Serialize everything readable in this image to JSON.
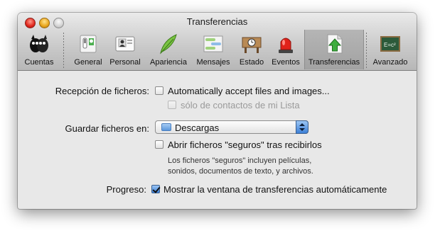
{
  "window": {
    "title": "Transferencias"
  },
  "toolbar": {
    "items": [
      {
        "label": "Cuentas",
        "icon": "accounts-icon"
      },
      {
        "label": "General",
        "icon": "general-switch-icon"
      },
      {
        "label": "Personal",
        "icon": "personal-card-icon"
      },
      {
        "label": "Apariencia",
        "icon": "feather-icon"
      },
      {
        "label": "Mensajes",
        "icon": "messages-icon"
      },
      {
        "label": "Estado",
        "icon": "status-sign-icon"
      },
      {
        "label": "Eventos",
        "icon": "siren-light-icon"
      },
      {
        "label": "Transferencias",
        "icon": "transfer-arrow-icon",
        "selected": true
      },
      {
        "label": "Avanzado",
        "icon": "chalkboard-icon"
      }
    ]
  },
  "form": {
    "reception_label": "Recepción de ficheros:",
    "auto_accept_label": "Automatically accept files and images...",
    "auto_accept_checked": false,
    "only_contacts_label": "sólo de contactos de mi Lista",
    "only_contacts_checked": false,
    "only_contacts_enabled": false,
    "save_in_label": "Guardar ficheros en:",
    "save_in_value": "Descargas",
    "open_safe_label": "Abrir ficheros \"seguros\" tras recibirlos",
    "open_safe_checked": false,
    "safe_note_line1": "Los ficheros \"seguros\" incluyen películas,",
    "safe_note_line2": "sonidos, documentos de texto, y archivos.",
    "progress_label": "Progreso:",
    "show_window_label": "Mostrar la ventana de transferencias automáticamente",
    "show_window_checked": true
  },
  "colors": {
    "accent": "#3b7fd6",
    "window_bg": "#e8e8e8"
  }
}
